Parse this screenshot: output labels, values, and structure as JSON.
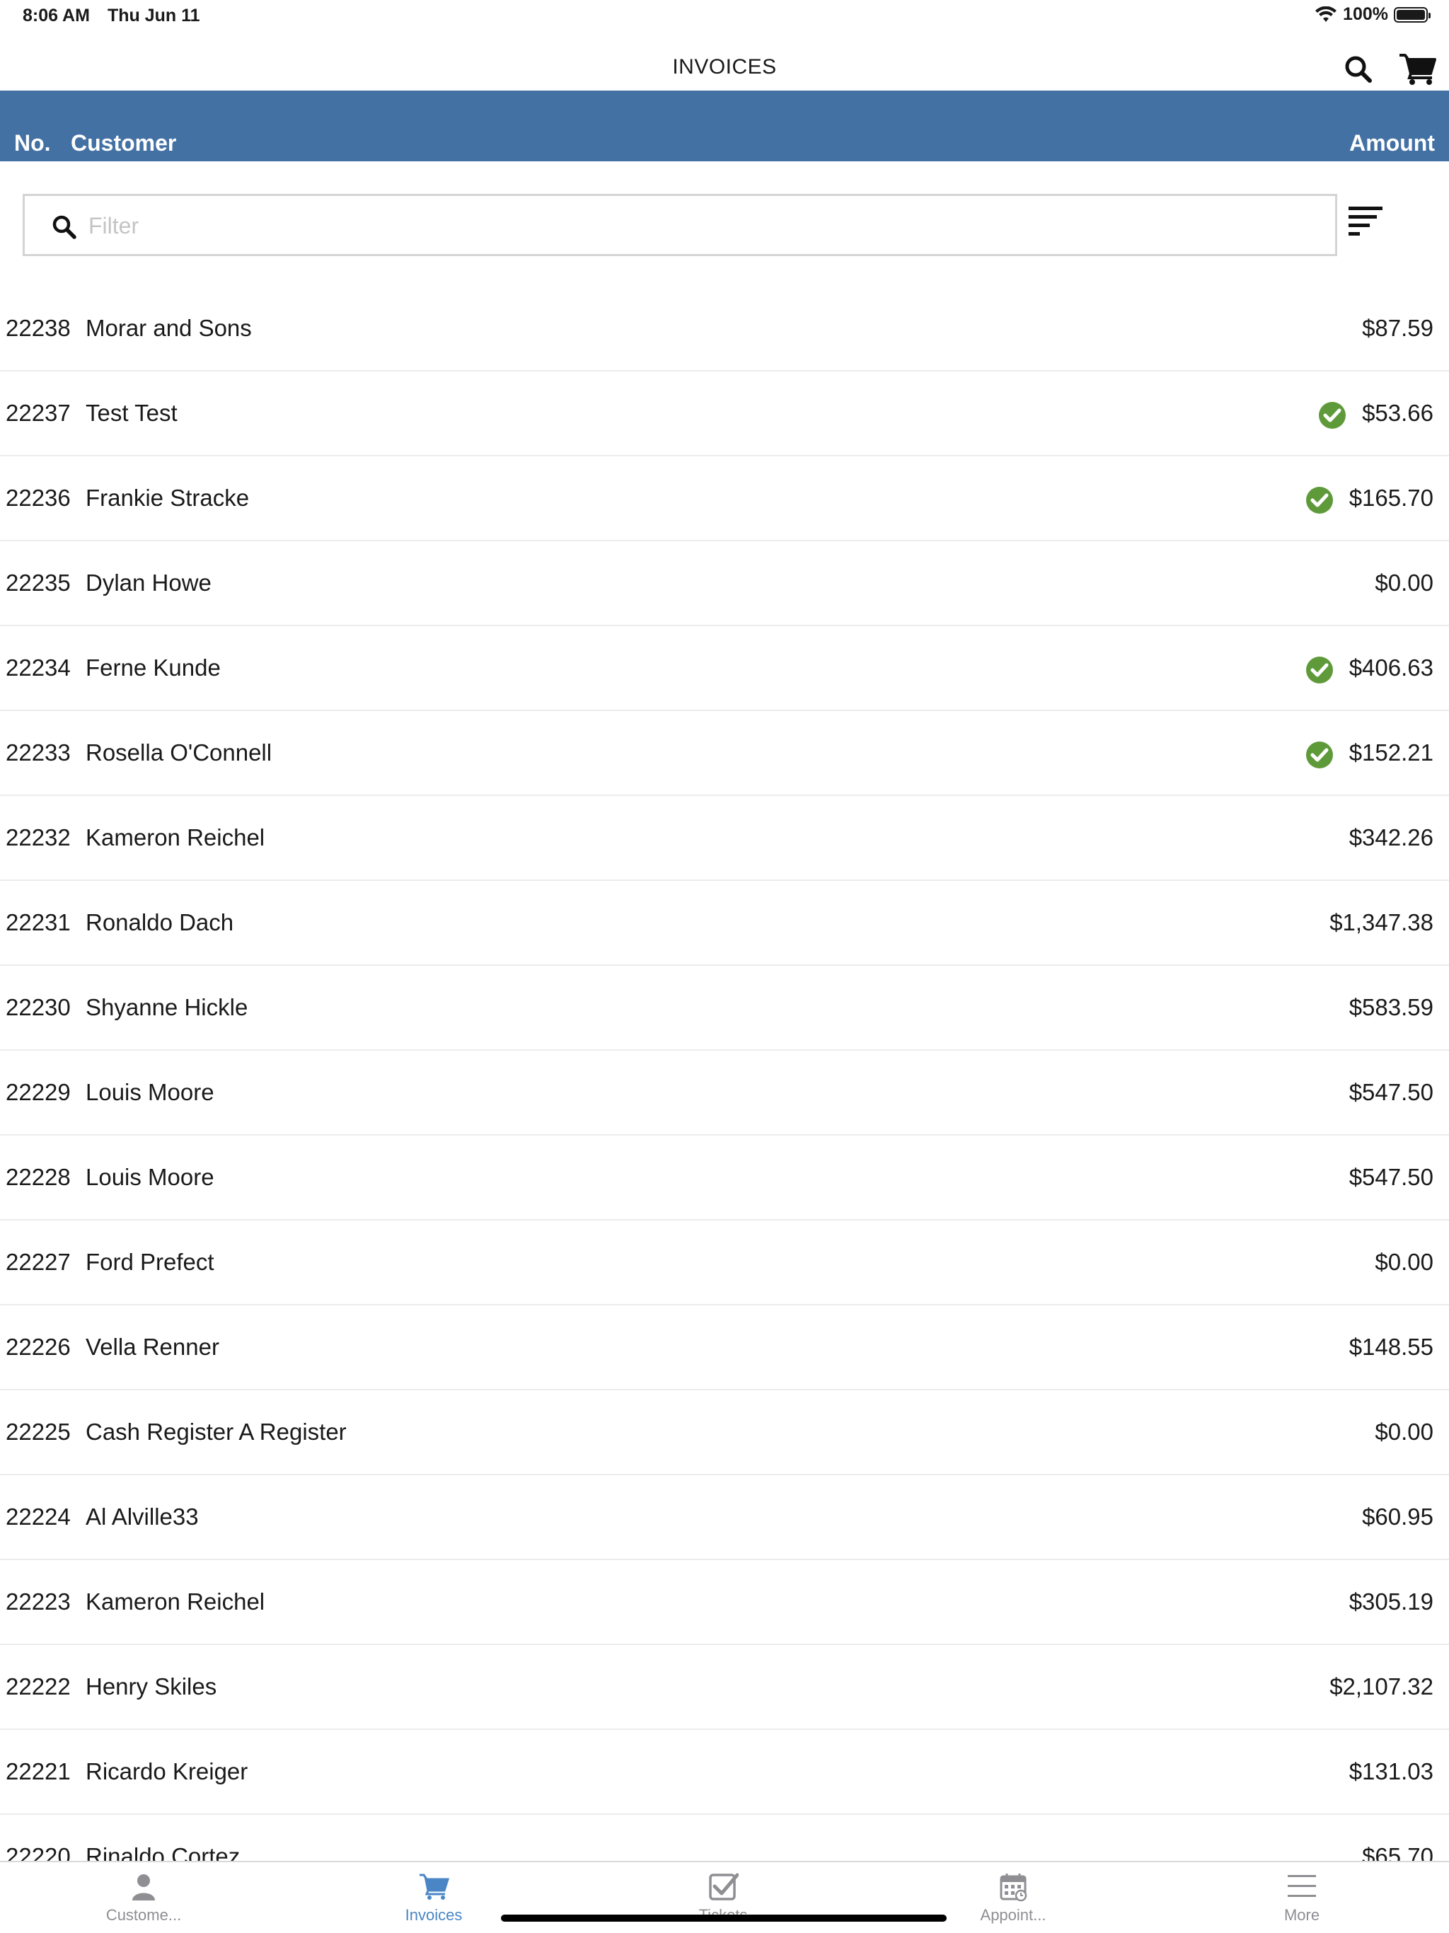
{
  "status_bar": {
    "time": "8:06 AM",
    "date": "Thu Jun 11",
    "battery": "100%"
  },
  "nav": {
    "title": "INVOICES"
  },
  "columns": {
    "no": "No.",
    "customer": "Customer",
    "amount": "Amount"
  },
  "filter": {
    "placeholder": "Filter",
    "value": ""
  },
  "invoices": [
    {
      "no": "22238",
      "customer": "Morar and Sons",
      "amount": "$87.59",
      "paid": false
    },
    {
      "no": "22237",
      "customer": "Test Test",
      "amount": "$53.66",
      "paid": true
    },
    {
      "no": "22236",
      "customer": "Frankie Stracke",
      "amount": "$165.70",
      "paid": true
    },
    {
      "no": "22235",
      "customer": "Dylan Howe",
      "amount": "$0.00",
      "paid": false
    },
    {
      "no": "22234",
      "customer": "Ferne Kunde",
      "amount": "$406.63",
      "paid": true
    },
    {
      "no": "22233",
      "customer": "Rosella O'Connell",
      "amount": "$152.21",
      "paid": true
    },
    {
      "no": "22232",
      "customer": "Kameron Reichel",
      "amount": "$342.26",
      "paid": false
    },
    {
      "no": "22231",
      "customer": "Ronaldo Dach",
      "amount": "$1,347.38",
      "paid": false
    },
    {
      "no": "22230",
      "customer": "Shyanne Hickle",
      "amount": "$583.59",
      "paid": false
    },
    {
      "no": "22229",
      "customer": "Louis Moore",
      "amount": "$547.50",
      "paid": false
    },
    {
      "no": "22228",
      "customer": "Louis Moore",
      "amount": "$547.50",
      "paid": false
    },
    {
      "no": "22227",
      "customer": "Ford Prefect",
      "amount": "$0.00",
      "paid": false
    },
    {
      "no": "22226",
      "customer": "Vella Renner",
      "amount": "$148.55",
      "paid": false
    },
    {
      "no": "22225",
      "customer": "Cash Register A Register",
      "amount": "$0.00",
      "paid": false
    },
    {
      "no": "22224",
      "customer": "Al Alville33",
      "amount": "$60.95",
      "paid": false
    },
    {
      "no": "22223",
      "customer": "Kameron Reichel",
      "amount": "$305.19",
      "paid": false
    },
    {
      "no": "22222",
      "customer": "Henry Skiles",
      "amount": "$2,107.32",
      "paid": false
    },
    {
      "no": "22221",
      "customer": "Ricardo Kreiger",
      "amount": "$131.03",
      "paid": false
    },
    {
      "no": "22220",
      "customer": "Rinaldo Cortez",
      "amount": "$65.70",
      "paid": false
    }
  ],
  "tabs": [
    {
      "label": "Custome...",
      "icon": "person-icon",
      "active": false
    },
    {
      "label": "Invoices",
      "icon": "cart-icon",
      "active": true
    },
    {
      "label": "Tickets",
      "icon": "checkbox-icon",
      "active": false
    },
    {
      "label": "Appoint...",
      "icon": "calendar-icon",
      "active": false
    },
    {
      "label": "More",
      "icon": "menu-icon",
      "active": false
    }
  ],
  "colors": {
    "header_blue": "#4471a3",
    "paid_green": "#5f9a3a",
    "tab_active": "#4a86c5",
    "tab_inactive": "#8e8e93"
  }
}
